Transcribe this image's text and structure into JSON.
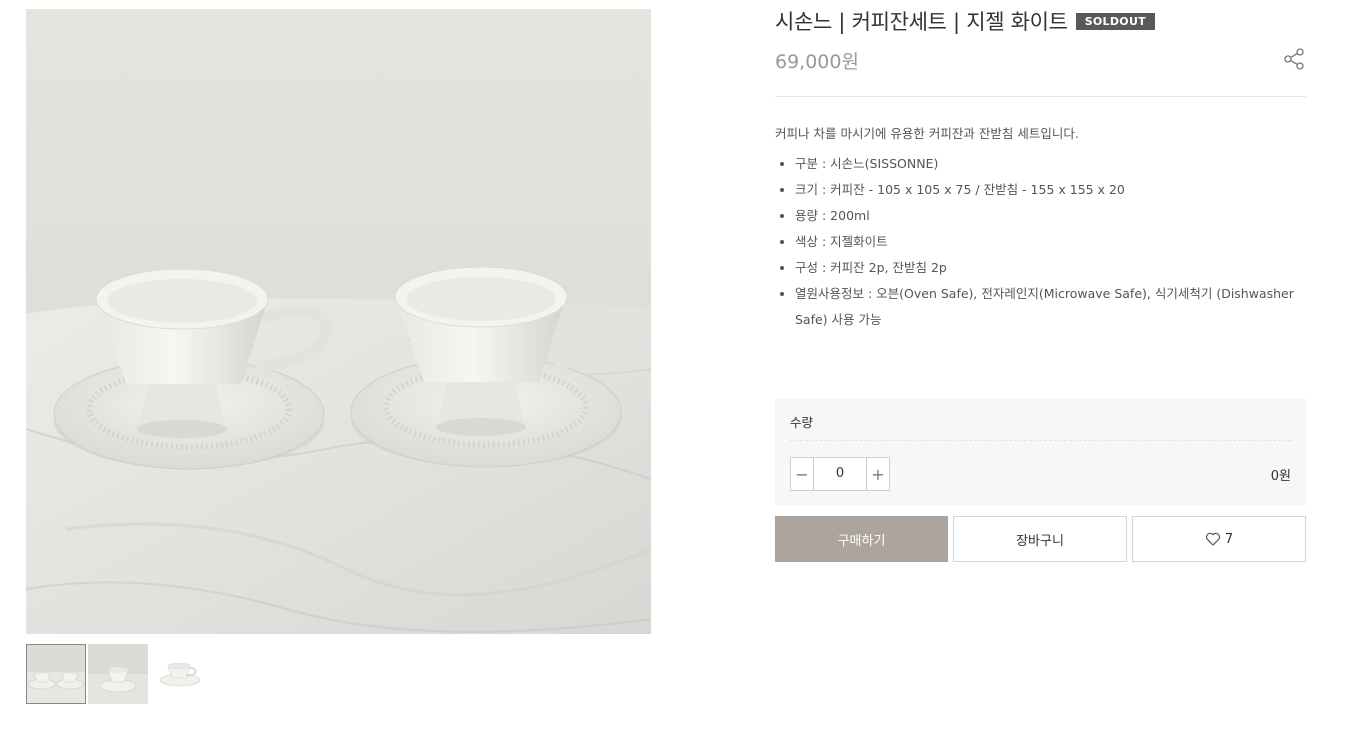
{
  "product": {
    "title": "시손느 | 커피잔세트 | 지젤 화이트",
    "badge": "SOLDOUT",
    "price": "69,000원"
  },
  "description": {
    "intro": "커피나 차를 마시기에 유용한 커피잔과 잔받침 세트입니다.",
    "specs": [
      "구분 : 시손느(SISSONNE)",
      "크기 : 커피잔 - 105 x 105 x 75 / 잔받침 - 155 x 155 x 20",
      "용량 : 200ml",
      "색상 : 지젤화이트",
      "구성 : 커피잔 2p, 잔받침 2p",
      "열원사용정보 : 오븐(Oven Safe), 전자레인지(Microwave Safe), 식기세척기 (Dishwasher Safe) 사용 가능"
    ]
  },
  "quantity": {
    "label": "수량",
    "minus": "−",
    "plus": "+",
    "value": "0",
    "total": "0원"
  },
  "buttons": {
    "buy": "구매하기",
    "cart": "장바구니",
    "wish_count": "7"
  },
  "icons": {
    "share": "share-icon",
    "wish": "heart-icon"
  },
  "colors": {
    "buy_button": "#ada59d",
    "soldout_badge": "#595959",
    "price": "#999999"
  },
  "gallery": {
    "thumbnail_count": 3,
    "active_thumbnail": 0
  }
}
